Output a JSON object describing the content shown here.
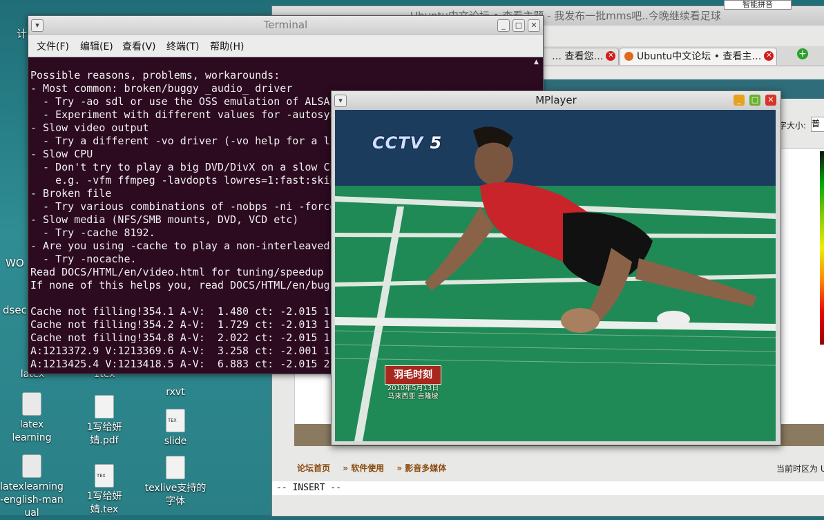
{
  "desktop": {
    "icons": [
      {
        "label": "latex",
        "kind": "folder"
      },
      {
        "label": "1tex",
        "kind": "folder"
      },
      {
        "label": "rxvt",
        "kind": "app"
      },
      {
        "label": "latex learning",
        "kind": "folder"
      },
      {
        "label": "1写给妍婧.pdf",
        "kind": "file"
      },
      {
        "label": "slide",
        "kind": "tex"
      },
      {
        "label": "latexlearning-english-manual",
        "kind": "folder"
      },
      {
        "label": "1写给妍婧.tex",
        "kind": "tex"
      },
      {
        "label": "texlive支持的字体",
        "kind": "file"
      }
    ],
    "edge_labels": [
      "计",
      "WO",
      "dsec"
    ]
  },
  "browser": {
    "title": "Ubuntu中文论坛 • 查看主题 - 我发布一批mms吧..今晚继续看足球",
    "tabs": [
      {
        "label": "… 查看您…",
        "active": false
      },
      {
        "label": "Ubuntu中文论坛 • 查看主…",
        "active": true
      }
    ],
    "new_tab_glyph": "+",
    "tab_close_glyph": "✕",
    "fontsize_label": "字大小:",
    "fontsize_value": "普",
    "breadcrumb": [
      "论坛首页",
      "» 软件使用",
      "» 影音多媒体"
    ],
    "timezone_text": "当前时区为 U",
    "vim_mode": "-- INSERT --",
    "ime_indicator": "智能拼音"
  },
  "terminal": {
    "title": "Terminal",
    "menu": [
      "文件(F)",
      "编辑(E)",
      "查看(V)",
      "终端(T)",
      "帮助(H)"
    ],
    "lines": [
      "Possible reasons, problems, workarounds:",
      "- Most common: broken/buggy _audio_ driver",
      "  - Try -ao sdl or use the OSS emulation of ALSA.",
      "  - Experiment with different values for -autosync",
      "- Slow video output",
      "  - Try a different -vo driver (-vo help for a list)",
      "- Slow CPU",
      "  - Don't try to play a big DVD/DivX on a slow CPU!",
      "    e.g. -vfm ffmpeg -lavdopts lowres=1:fast:skip",
      "- Broken file",
      "  - Try various combinations of -nobps -ni -forceidx",
      "- Slow media (NFS/SMB mounts, DVD, VCD etc)",
      "  - Try -cache 8192.",
      "- Are you using -cache to play a non-interleaved",
      "  - Try -nocache.",
      "Read DOCS/HTML/en/video.html for tuning/speedup",
      "If none of this helps you, read DOCS/HTML/en/bug",
      "",
      "Cache not filling!354.1 A-V:  1.480 ct: -2.015 1",
      "Cache not filling!354.2 A-V:  1.729 ct: -2.013 1",
      "Cache not filling!354.8 A-V:  2.022 ct: -2.015 1",
      "A:1213372.9 V:1213369.6 A-V:  3.258 ct: -2.001 1",
      "A:1213425.4 V:1213418.5 A-V:  6.883 ct: -2.015 2"
    ]
  },
  "mplayer": {
    "title": "MPlayer",
    "overlay_logo": "CCTV",
    "overlay_channel": "5",
    "overlay_badge": "羽毛时刻",
    "overlay_date": "2010年5月13日",
    "overlay_sub": "马来西亚 吉隆坡"
  },
  "colors": {
    "terminal_bg": "#2c0a20",
    "desktop_bg": "#2a7f86",
    "court_green": "#1d7d4d",
    "player_shirt": "#c8242a",
    "mp_close": "#d8352a",
    "mp_minimize": "#e6a21c",
    "mp_maximize": "#6ab030"
  }
}
